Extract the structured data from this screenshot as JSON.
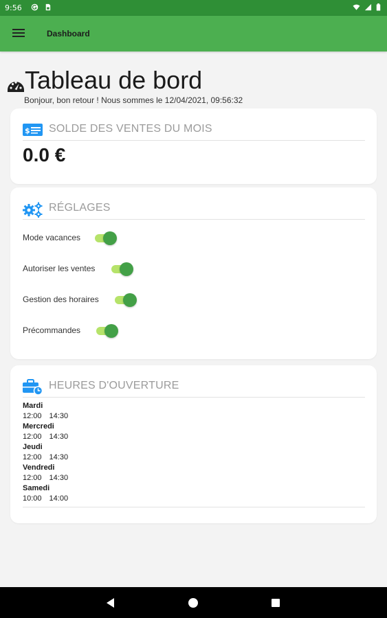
{
  "status_bar": {
    "time": "9:56",
    "icons": [
      "notification-g-icon",
      "sim-card-icon",
      "wifi-icon",
      "signal-icon",
      "battery-icon"
    ]
  },
  "app_bar": {
    "title": "Dashboard",
    "menu_icon": "hamburger-menu-icon"
  },
  "header": {
    "title": "Tableau de bord",
    "subtitle": "Bonjour, bon retour ! Nous sommes le 12/04/2021, 09:56:32",
    "icon": "speedometer-icon"
  },
  "sales_card": {
    "title": "SOLDE DES VENTES DU MOIS",
    "icon": "money-card-icon",
    "amount": "0.0 €"
  },
  "settings_card": {
    "title": "RÉGLAGES",
    "icon": "gears-icon",
    "items": [
      {
        "label": "Mode vacances",
        "enabled": true
      },
      {
        "label": "Autoriser les ventes",
        "enabled": true
      },
      {
        "label": "Gestion des horaires",
        "enabled": true
      },
      {
        "label": "Précommandes",
        "enabled": true
      }
    ]
  },
  "hours_card": {
    "title": "HEURES D'OUVERTURE",
    "icon": "briefcase-clock-icon",
    "days": [
      {
        "day": "Mardi",
        "open": "12:00",
        "close": "14:30"
      },
      {
        "day": "Mercredi",
        "open": "12:00",
        "close": "14:30"
      },
      {
        "day": "Jeudi",
        "open": "12:00",
        "close": "14:30"
      },
      {
        "day": "Vendredi",
        "open": "12:00",
        "close": "14:30"
      },
      {
        "day": "Samedi",
        "open": "10:00",
        "close": "14:00"
      }
    ]
  },
  "nav_bar": {
    "icons": [
      "back-icon",
      "home-icon",
      "recents-icon"
    ]
  },
  "colors": {
    "status_bar": "#2f8f36",
    "app_bar": "#4caf50",
    "accent_blue": "#2196f3",
    "toggle_thumb": "#43a047",
    "toggle_track": "#b6e36a",
    "background": "#f3f3f3"
  }
}
